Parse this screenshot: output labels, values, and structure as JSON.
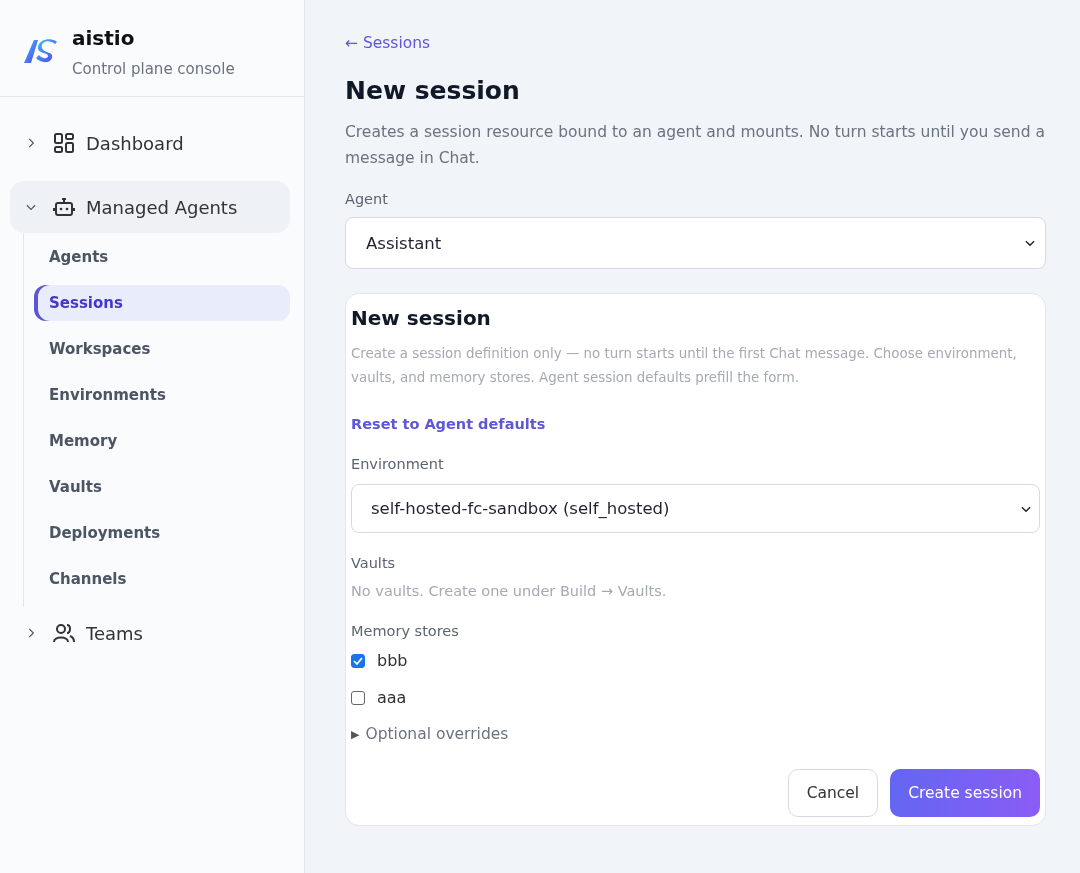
{
  "brand": {
    "name": "aistio",
    "subtitle": "Control plane console"
  },
  "nav": [
    {
      "label": "Dashboard",
      "expanded": false,
      "selected": false
    },
    {
      "label": "Managed Agents",
      "expanded": true,
      "selected": true,
      "children": [
        {
          "label": "Agents",
          "selected": false
        },
        {
          "label": "Sessions",
          "selected": true
        },
        {
          "label": "Workspaces",
          "selected": false
        },
        {
          "label": "Environments",
          "selected": false
        },
        {
          "label": "Memory",
          "selected": false
        },
        {
          "label": "Vaults",
          "selected": false
        },
        {
          "label": "Deployments",
          "selected": false
        },
        {
          "label": "Channels",
          "selected": false
        }
      ]
    },
    {
      "label": "Teams",
      "expanded": false,
      "selected": false
    }
  ],
  "back_link": "← Sessions",
  "title": "New session",
  "description": "Creates a session resource bound to an agent and mounts. No turn starts until you send a message in Chat.",
  "agent_field": {
    "label": "Agent",
    "value": "Assistant"
  },
  "card": {
    "title": "New session",
    "description": "Create a session definition only — no turn starts until the first Chat message. Choose environment, vaults, and memory stores. Agent session defaults prefill the form.",
    "reset_link": "Reset to Agent defaults",
    "environment": {
      "label": "Environment",
      "value": "self-hosted-fc-sandbox (self_hosted)"
    },
    "vaults": {
      "label": "Vaults",
      "empty_text": "No vaults. Create one under Build → Vaults."
    },
    "memory_stores": {
      "label": "Memory stores",
      "items": [
        {
          "label": "bbb",
          "checked": true
        },
        {
          "label": "aaa",
          "checked": false
        }
      ]
    },
    "optional_overrides": {
      "marker": "▶",
      "label": "Optional overrides",
      "expanded": false
    },
    "buttons": [
      {
        "label": "Cancel",
        "kind": "secondary"
      },
      {
        "label": "Create session",
        "kind": "primary"
      }
    ]
  }
}
